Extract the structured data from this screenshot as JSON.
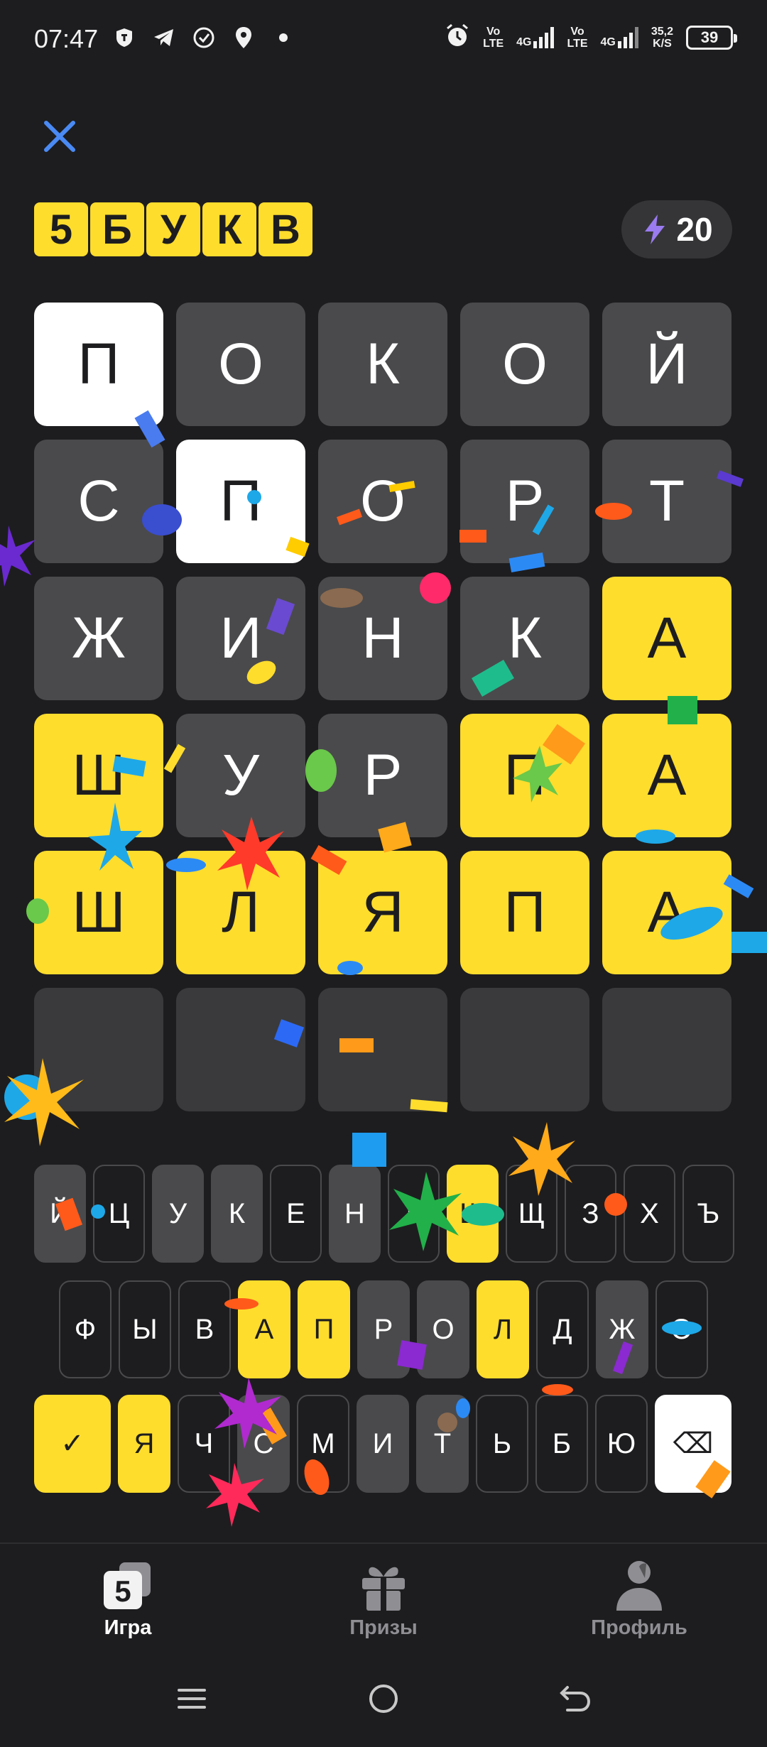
{
  "status_bar": {
    "time": "07:47",
    "volte1": [
      "Vo",
      "LTE"
    ],
    "net1": "4G",
    "volte2": [
      "Vo",
      "LTE"
    ],
    "net2": "4G",
    "speed": [
      "35,2",
      "K/S"
    ],
    "battery": "39",
    "icons": [
      "shield-icon",
      "telegram-icon",
      "check-circle-icon",
      "location-icon",
      "dot-icon",
      "alarm-icon",
      "signal-icon",
      "battery-icon"
    ]
  },
  "header": {
    "logo_letters": [
      "5",
      "Б",
      "У",
      "К",
      "В"
    ],
    "energy_count": "20",
    "energy_icon": "lightning-icon",
    "close_icon": "close-icon"
  },
  "colors": {
    "accent": "#ffdd2d",
    "tile": "#4a4a4c",
    "empty": "#3a3a3c",
    "background": "#1d1d1f",
    "close": "#4a8af4"
  },
  "grid": [
    [
      {
        "l": "П",
        "s": "white"
      },
      {
        "l": "О",
        "s": "gray"
      },
      {
        "l": "К",
        "s": "gray"
      },
      {
        "l": "О",
        "s": "gray"
      },
      {
        "l": "Й",
        "s": "gray"
      }
    ],
    [
      {
        "l": "С",
        "s": "gray"
      },
      {
        "l": "П",
        "s": "white"
      },
      {
        "l": "О",
        "s": "gray"
      },
      {
        "l": "Р",
        "s": "gray"
      },
      {
        "l": "Т",
        "s": "gray"
      }
    ],
    [
      {
        "l": "Ж",
        "s": "gray"
      },
      {
        "l": "И",
        "s": "gray"
      },
      {
        "l": "Н",
        "s": "gray"
      },
      {
        "l": "К",
        "s": "gray"
      },
      {
        "l": "А",
        "s": "yellow"
      }
    ],
    [
      {
        "l": "Ш",
        "s": "yellow"
      },
      {
        "l": "У",
        "s": "gray"
      },
      {
        "l": "Р",
        "s": "gray"
      },
      {
        "l": "П",
        "s": "yellow"
      },
      {
        "l": "А",
        "s": "yellow"
      }
    ],
    [
      {
        "l": "Ш",
        "s": "yellow"
      },
      {
        "l": "Л",
        "s": "yellow"
      },
      {
        "l": "Я",
        "s": "yellow"
      },
      {
        "l": "П",
        "s": "yellow"
      },
      {
        "l": "А",
        "s": "yellow"
      }
    ],
    [
      {
        "l": "",
        "s": "empty"
      },
      {
        "l": "",
        "s": "empty"
      },
      {
        "l": "",
        "s": "empty"
      },
      {
        "l": "",
        "s": "empty"
      },
      {
        "l": "",
        "s": "empty"
      }
    ]
  ],
  "keyboard": {
    "row1": [
      {
        "k": "Й",
        "s": "dark"
      },
      {
        "k": "Ц",
        "s": "none"
      },
      {
        "k": "У",
        "s": "dark"
      },
      {
        "k": "К",
        "s": "dark"
      },
      {
        "k": "Е",
        "s": "none"
      },
      {
        "k": "Н",
        "s": "dark"
      },
      {
        "k": "Г",
        "s": "none"
      },
      {
        "k": "Ш",
        "s": "yellow"
      },
      {
        "k": "Щ",
        "s": "none"
      },
      {
        "k": "З",
        "s": "none"
      },
      {
        "k": "Х",
        "s": "none"
      },
      {
        "k": "Ъ",
        "s": "none"
      }
    ],
    "row2": [
      {
        "k": "Ф",
        "s": "none"
      },
      {
        "k": "Ы",
        "s": "none"
      },
      {
        "k": "В",
        "s": "none"
      },
      {
        "k": "А",
        "s": "yellow"
      },
      {
        "k": "П",
        "s": "yellow"
      },
      {
        "k": "Р",
        "s": "dark"
      },
      {
        "k": "О",
        "s": "dark"
      },
      {
        "k": "Л",
        "s": "yellow"
      },
      {
        "k": "Д",
        "s": "none"
      },
      {
        "k": "Ж",
        "s": "dark"
      },
      {
        "k": "Э",
        "s": "none"
      }
    ],
    "row3": [
      {
        "k": "✓",
        "s": "yellow",
        "name": "submit-check-key"
      },
      {
        "k": "Я",
        "s": "yellow"
      },
      {
        "k": "Ч",
        "s": "none"
      },
      {
        "k": "С",
        "s": "dark"
      },
      {
        "k": "М",
        "s": "none"
      },
      {
        "k": "И",
        "s": "dark"
      },
      {
        "k": "Т",
        "s": "dark"
      },
      {
        "k": "Ь",
        "s": "none"
      },
      {
        "k": "Б",
        "s": "none"
      },
      {
        "k": "Ю",
        "s": "none"
      },
      {
        "k": "⌫",
        "s": "white",
        "name": "backspace-key"
      }
    ]
  },
  "bottom_nav": [
    {
      "label": "Игра",
      "icon": "game-5-icon",
      "active": true
    },
    {
      "label": "Призы",
      "icon": "gift-icon",
      "active": false
    },
    {
      "label": "Профиль",
      "icon": "profile-icon",
      "active": false
    }
  ],
  "system_nav": [
    "menu-icon",
    "home-icon",
    "back-icon"
  ]
}
